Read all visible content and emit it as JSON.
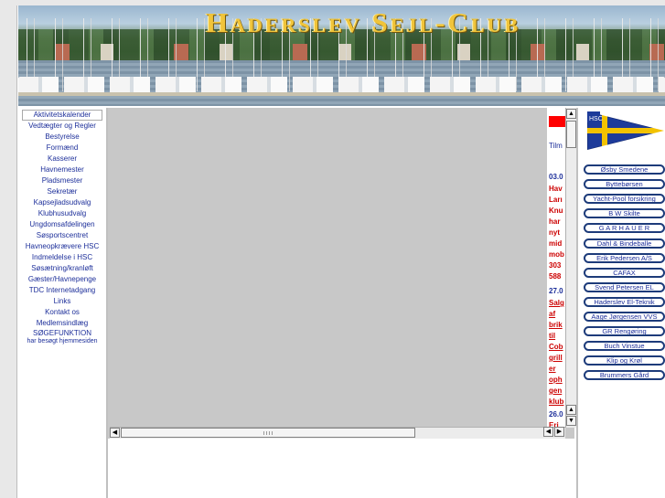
{
  "banner": {
    "title": "Haderslev Sejl-Club"
  },
  "nav": {
    "items": [
      "Aktivitetskalender",
      "Vedtægter og Regler",
      "Bestyrelse",
      "Formænd",
      "Kasserer",
      "Havnemester",
      "Pladsmester",
      "Sekretær",
      "Kapsejladsudvalg",
      "Klubhusudvalg",
      "Ungdomsafdelingen",
      "Søsportscentret",
      "Havneopkrævere HSC",
      "Indmeldelse i HSC",
      "Søsætning/kranløft",
      "Gæster/Havnepenge",
      "TDC Internetadgang",
      "Links",
      "Kontakt os",
      "Medlemsindlæg",
      "SØGEFUNKTION"
    ],
    "search_note": "har besøgt hjemmesiden"
  },
  "news": {
    "intro": "Tilm",
    "item1_date": "03.0",
    "item1_lines": [
      "Hav",
      "Ları",
      "Knu",
      "har",
      "nyt",
      "mid",
      "mob",
      "303",
      "588"
    ],
    "item2_date": "27.0",
    "item2_lines": [
      "Salg",
      "af",
      "brik",
      "til",
      "Cob",
      "grill",
      "er",
      "oph",
      "gen",
      "klub"
    ],
    "item3_date": "26.0",
    "item3_lines": [
      "Eri"
    ]
  },
  "right": {
    "pennant_label": "HSC",
    "sponsors": [
      "Øsby Smedene",
      "Byttebørsen",
      "Yacht-Pool forsikring",
      "B W Skilte",
      "G A R H A U E R",
      "Dahl & Bindeballe",
      "Erik Pedersen A/S",
      "CAFAX",
      "Svend Petersen EL",
      "Haderslev El-Teknik",
      "Aage Jørgensen VVS",
      "GR Rengøring",
      "Buch Vinstue",
      "Klip og Krøl",
      "Brummers Gård"
    ]
  },
  "colors": {
    "link": "#1d2f9a",
    "news_red": "#cc0000",
    "frame_gray": "#c8c8c8",
    "pennant_blue": "#1d3b9a",
    "pennant_yellow": "#f2c200"
  },
  "icons": [
    "scroll-up-icon",
    "scroll-down-icon",
    "scroll-left-icon",
    "scroll-right-icon"
  ]
}
